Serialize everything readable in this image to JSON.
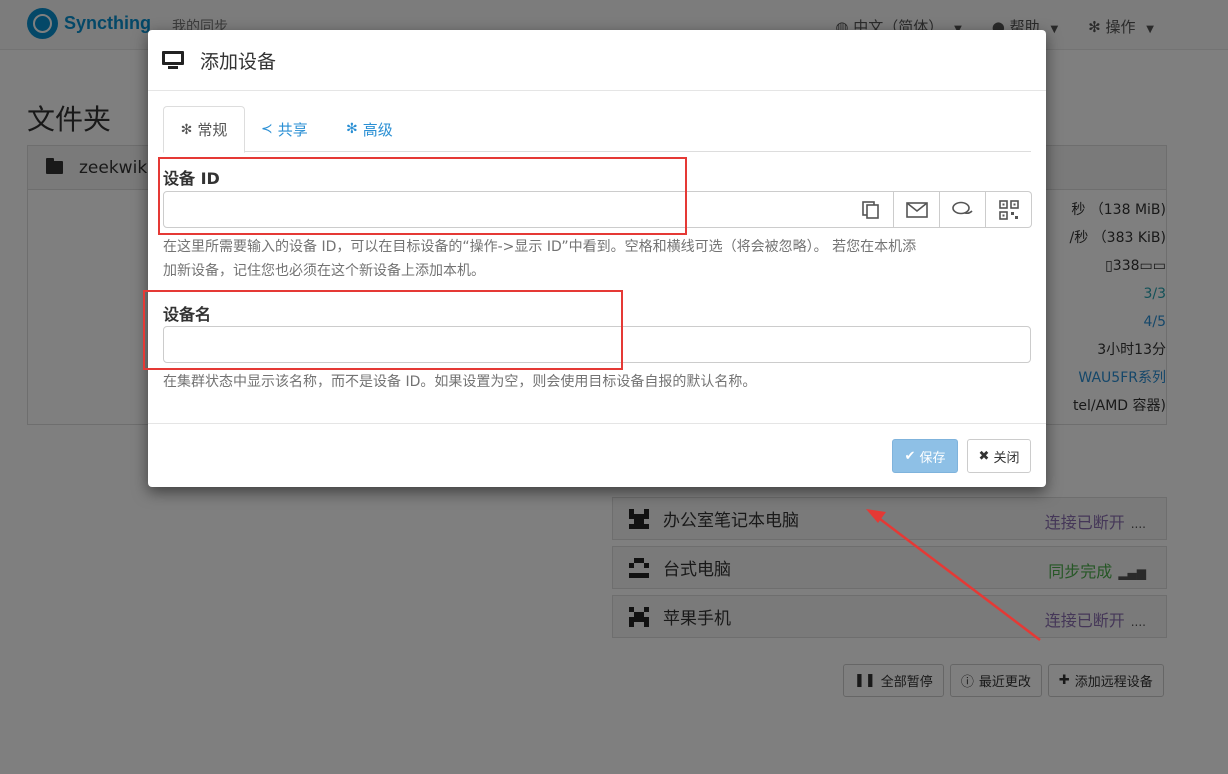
{
  "navbar": {
    "brand": "Syncthing",
    "left_link": "我的同步",
    "language": "中文（简体）",
    "help": "帮助",
    "actions": "操作"
  },
  "page": {
    "title": "文件夹",
    "folder_name": "zeekwik"
  },
  "stats": {
    "row1": "秒 （138 MiB)",
    "row2": "/秒 （383 KiB)",
    "row3": "338",
    "row4": "3/3",
    "row5": "4/5",
    "row6": "3小时13分",
    "row7": "WAU5FR系列",
    "row8": "tel/AMD 容器)"
  },
  "devices": [
    {
      "name": "办公室笔记本电脑",
      "status": "连接已断开",
      "indicator": "....",
      "status_color": "#8a6fb0"
    },
    {
      "name": "台式电脑",
      "status": "同步完成",
      "indicator": "signal",
      "status_color": "#4cae4c"
    },
    {
      "name": "苹果手机",
      "status": "连接已断开",
      "indicator": "....",
      "status_color": "#8a6fb0"
    }
  ],
  "bottom_buttons": {
    "pause_all": "全部暂停",
    "recent_changes": "最近更改",
    "add_remote": "添加远程设备"
  },
  "modal": {
    "title": "添加设备",
    "tabs": [
      {
        "label": "常规",
        "icon": "gear-icon"
      },
      {
        "label": "共享",
        "icon": "share-icon"
      },
      {
        "label": "高级",
        "icon": "cogs-icon"
      }
    ],
    "device_id_label": "设备 ID",
    "device_id_value": "",
    "device_id_help_line1": "在这里所需要输入的设备 ID，可以在目标设备的“操作->显示 ID”中看到。空格和横线可选（将会被忽略）。 若您在本机添",
    "device_id_help_line2": "加新设备，记住您也必须在这个新设备上添加本机。",
    "device_name_label": "设备名",
    "device_name_value": "",
    "device_name_help": "在集群状态中显示该名称，而不是设备 ID。如果设置为空，则会使用目标设备自报的默认名称。",
    "save_label": "保存",
    "close_label": "关闭"
  },
  "colors": {
    "accent": "#2a8fd4",
    "brand": "#0891d1",
    "annotation": "#e53935",
    "disconnected": "#8a6fb0",
    "synced": "#4cae4c"
  }
}
